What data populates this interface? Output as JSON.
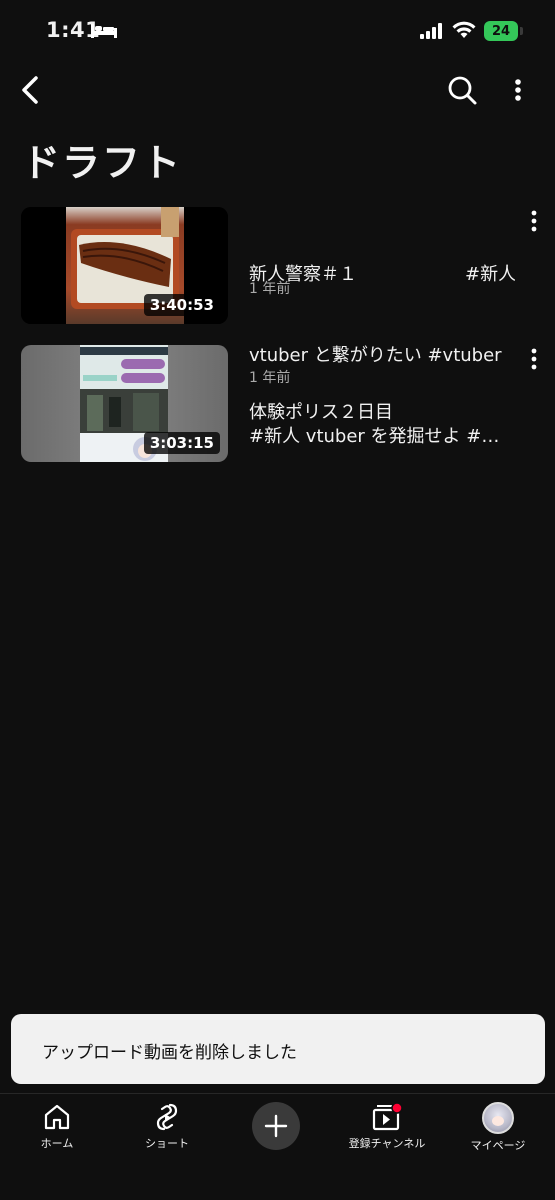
{
  "status_bar": {
    "time": "1:41",
    "battery": "24"
  },
  "header": {
    "title": "ドラフト"
  },
  "videos": [
    {
      "title_lines": [
        "新人警察＃１　　　　　　#新人",
        "vtuber と繋がりたい #vtuber",
        "#新人 vtuber を発掘せよ #…"
      ],
      "meta": "1 年前",
      "duration": "3:40:53"
    },
    {
      "title_lines": [
        "体験ポリス２日目"
      ],
      "meta": "1 年前",
      "duration": "3:03:15"
    }
  ],
  "toast": {
    "text": "アップロード動画を削除しました"
  },
  "bottom_nav": {
    "home": "ホーム",
    "shorts": "ショート",
    "subscriptions": "登録チャンネル",
    "me": "マイページ"
  }
}
